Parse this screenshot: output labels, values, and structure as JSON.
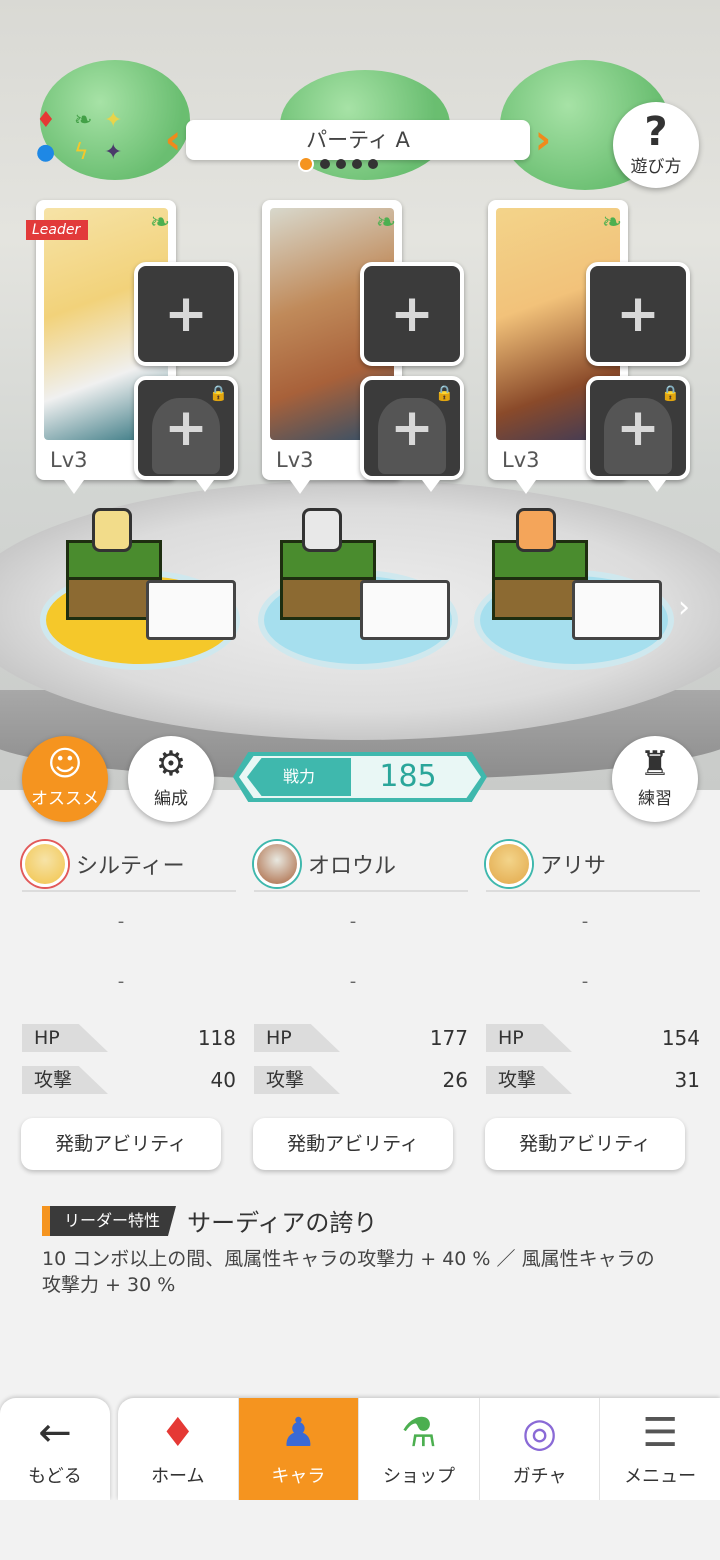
{
  "party": {
    "title": "パーティ A",
    "pages": 5,
    "current_page": 1
  },
  "help": {
    "label": "遊び方",
    "icon": "question-icon"
  },
  "element_icons": [
    "diamond-red",
    "leaf-green",
    "sparkle-yellow",
    "circle-blue",
    "bolt-yellow",
    "star-purple"
  ],
  "characters": [
    {
      "name": "シルティー",
      "level": "Lv3",
      "leader_tag": "Leader",
      "hp": "118",
      "attack": "40",
      "dash1": "-",
      "dash2": "-",
      "ability_label": "発動アビリティ",
      "accent": "#f5c82a"
    },
    {
      "name": "オロウル",
      "level": "Lv3",
      "hp": "177",
      "attack": "26",
      "dash1": "-",
      "dash2": "-",
      "ability_label": "発動アビリティ",
      "accent": "#a6dfee"
    },
    {
      "name": "アリサ",
      "level": "Lv3",
      "hp": "154",
      "attack": "31",
      "dash1": "-",
      "dash2": "-",
      "ability_label": "発動アビリティ",
      "accent": "#a6dfee"
    }
  ],
  "stat_labels": {
    "hp": "HP",
    "attack": "攻撃"
  },
  "buttons": {
    "recommend": "オススメ",
    "formation": "編成",
    "practice": "練習"
  },
  "power": {
    "label": "戦力",
    "value": "185"
  },
  "leader_trait": {
    "tag": "リーダー特性",
    "name": "サーディアの誇り",
    "description": "10 コンボ以上の間、風属性キャラの攻撃力 + 40 % ／ 風属性キャラの攻撃力 + 30 %"
  },
  "nav": {
    "back": "もどる",
    "items": [
      {
        "label": "ホーム",
        "icon": "home-icon"
      },
      {
        "label": "キャラ",
        "icon": "character-icon",
        "active": true
      },
      {
        "label": "ショップ",
        "icon": "shop-icon"
      },
      {
        "label": "ガチャ",
        "icon": "gacha-icon"
      },
      {
        "label": "メニュー",
        "icon": "menu-icon"
      }
    ]
  },
  "colors": {
    "accent_orange": "#f5941f",
    "teal": "#3fb8ad",
    "leaf_green": "#4caf50"
  }
}
